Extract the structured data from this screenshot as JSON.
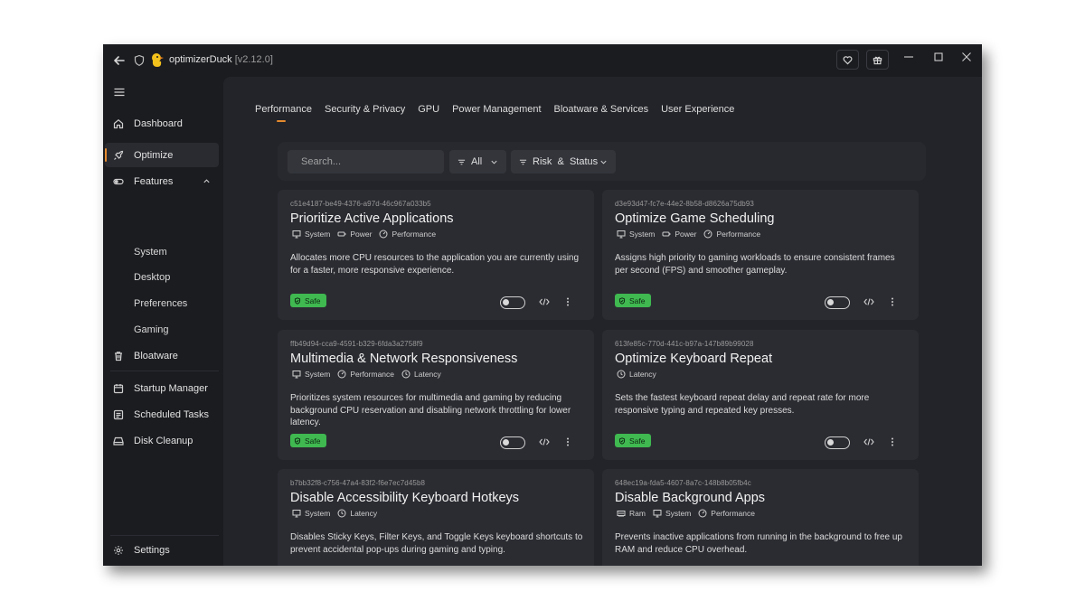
{
  "window": {
    "app_name": "optimizerDuck",
    "version": "[v2.12.0]"
  },
  "titlebar": {
    "back_icon": "arrow-left-icon",
    "shield_icon": "shield-icon",
    "heart_icon": "heart-icon",
    "gift_icon": "gift-icon"
  },
  "sidebar": {
    "items": [
      {
        "label": "Dashboard",
        "icon": "home-icon"
      },
      {
        "label": "Optimize",
        "icon": "rocket-icon",
        "active": true
      },
      {
        "label": "Features",
        "icon": "toggle-icon"
      },
      {
        "label": "Bloatware",
        "icon": "trash-icon"
      },
      {
        "label": "Startup Manager",
        "icon": "calendar-icon"
      },
      {
        "label": "Scheduled Tasks",
        "icon": "list-icon"
      },
      {
        "label": "Disk Cleanup",
        "icon": "drive-icon"
      }
    ],
    "features_sub": [
      "System",
      "Desktop",
      "Preferences",
      "Gaming"
    ],
    "settings": "Settings"
  },
  "tabs": [
    "Performance",
    "Security & Privacy",
    "GPU",
    "Power Management",
    "Bloatware & Services",
    "User Experience"
  ],
  "filters": {
    "search_placeholder": "Search...",
    "all": "All",
    "risk": "Risk  &  Status"
  },
  "accent_color": "#e58a2f",
  "safe_color": "#3fb950",
  "cards": [
    {
      "id": "c51e4187-be49-4376-a97d-46c967a033b5",
      "title": "Prioritize Active Applications",
      "tags": [
        "System",
        "Power",
        "Performance"
      ],
      "desc": "Allocates more CPU resources to the application you are currently using for a faster, more responsive experience.",
      "badge": "Safe"
    },
    {
      "id": "d3e93d47-fc7e-44e2-8b58-d8626a75db93",
      "title": "Optimize Game Scheduling",
      "tags": [
        "System",
        "Power",
        "Performance"
      ],
      "desc": "Assigns high priority to gaming workloads to ensure consistent frames per second (FPS) and smoother gameplay.",
      "badge": "Safe"
    },
    {
      "id": "ffb49d94-cca9-4591-b329-6fda3a2758f9",
      "title": "Multimedia & Network Responsiveness",
      "tags": [
        "System",
        "Performance",
        "Latency"
      ],
      "desc": "Prioritizes system resources for multimedia and gaming by reducing background CPU reservation and disabling network throttling for lower latency.",
      "badge": "Safe"
    },
    {
      "id": "613fe85c-770d-441c-b97a-147b89b99028",
      "title": "Optimize Keyboard Repeat",
      "tags": [
        "Latency"
      ],
      "desc": "Sets the fastest keyboard repeat delay and repeat rate for more responsive typing and repeated key presses.",
      "badge": "Safe"
    },
    {
      "id": "b7bb32f8-c756-47a4-83f2-f6e7ec7d45b8",
      "title": "Disable Accessibility Keyboard Hotkeys",
      "tags": [
        "System",
        "Latency"
      ],
      "desc": "Disables Sticky Keys, Filter Keys, and Toggle Keys keyboard shortcuts to prevent accidental pop-ups during gaming and typing.",
      "badge": ""
    },
    {
      "id": "648ec19a-fda5-4607-8a7c-148b8b05fb4c",
      "title": "Disable Background Apps",
      "tags": [
        "Ram",
        "System",
        "Performance"
      ],
      "desc": "Prevents inactive applications from running in the background to free up RAM and reduce CPU overhead.",
      "badge": ""
    }
  ]
}
